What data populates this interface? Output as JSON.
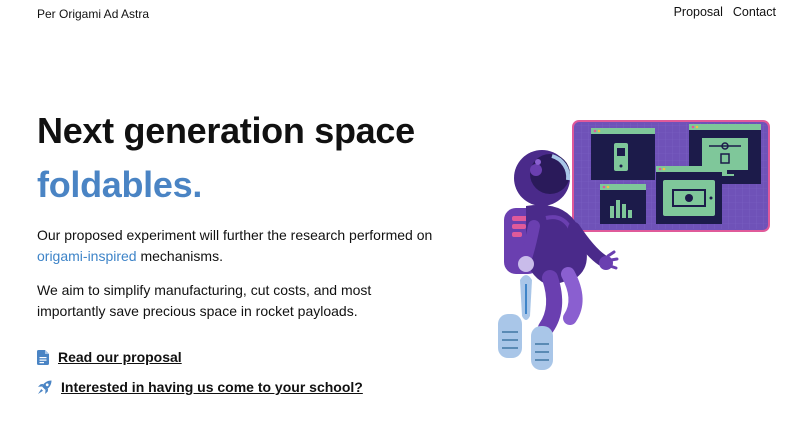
{
  "header": {
    "brand": "Per Origami Ad Astra",
    "nav": [
      "Proposal",
      "Contact"
    ]
  },
  "hero": {
    "title_line1": "Next generation space",
    "title_line2": "foldables.",
    "p1_before": "Our proposed experiment will further the research performed on ",
    "p1_link": "origami-inspired",
    "p1_after": " mechanisms.",
    "p2": "We aim to simplify manufacturing, cut costs, and most importantly save precious space in rocket payloads."
  },
  "links": [
    {
      "icon": "document-icon",
      "label": "Read our proposal"
    },
    {
      "icon": "rocket-icon",
      "label": "Interested in having us come to your school?"
    }
  ],
  "illustration": {
    "subject": "astronaut with dashboard",
    "colors": {
      "accent": "#4a84c4",
      "purple": "#6a3fb0",
      "pink": "#e05a9a",
      "navy": "#1c1b4a",
      "green": "#7fc79a"
    }
  }
}
